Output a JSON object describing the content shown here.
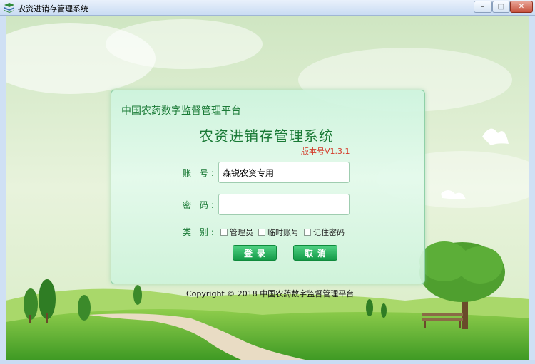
{
  "window": {
    "title": "农资进销存管理系统",
    "min_label": "–",
    "max_label": "□",
    "close_label": "✕"
  },
  "login": {
    "platform_name": "中国农药数字监督管理平台",
    "system_name": "农资进销存管理系统",
    "version": "版本号V1.3.1",
    "account_label": "账 号:",
    "account_value": "森锐农资专用",
    "password_label": "密 码:",
    "password_value": "",
    "type_label": "类 别:",
    "options": {
      "admin": "管理员",
      "temp_account": "临时账号",
      "remember": "记住密码"
    },
    "login_button": "登录",
    "cancel_button": "取消"
  },
  "footer": {
    "copyright": "Copyright © 2018 中国农药数字监督管理平台"
  }
}
